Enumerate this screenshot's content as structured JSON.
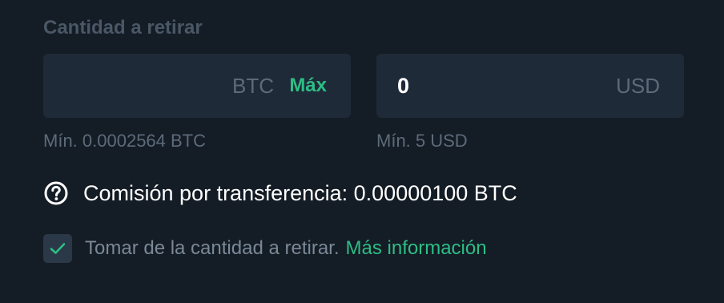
{
  "withdraw": {
    "label": "Cantidad a retirar",
    "btc_field": {
      "value": "",
      "unit": "BTC",
      "max_label": "Máx",
      "min_text": "Mín. 0.0002564 BTC"
    },
    "usd_field": {
      "value": "0",
      "unit": "USD",
      "min_text": "Mín. 5 USD"
    }
  },
  "fee": {
    "icon": "question-circle-icon",
    "text": "Comisión por transferencia: 0.00000100 BTC"
  },
  "deduct_option": {
    "checked": true,
    "icon": "check-icon",
    "text": "Tomar de la cantidad a retirar.",
    "link_text": "Más información"
  },
  "colors": {
    "background": "#141c25",
    "field_background": "#1e2a38",
    "accent": "#2ebd85",
    "muted_text": "#5c6b7a"
  }
}
